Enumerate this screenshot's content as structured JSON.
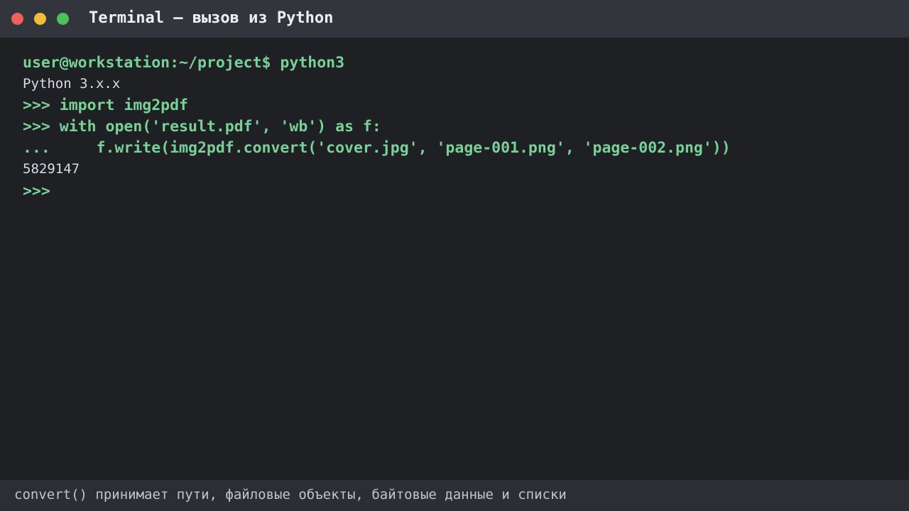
{
  "window": {
    "title": "Terminal — вызов из Python",
    "controls": {
      "close_color": "#f0605a",
      "minimize_color": "#f4bd38",
      "maximize_color": "#4cc15c"
    }
  },
  "terminal": {
    "lines": [
      {
        "kind": "command",
        "text": "user@workstation:~/project$ python3"
      },
      {
        "kind": "output",
        "text": "Python 3.x.x"
      },
      {
        "kind": "command",
        "text": ">>> import img2pdf"
      },
      {
        "kind": "command",
        "text": ">>> with open('result.pdf', 'wb') as f:"
      },
      {
        "kind": "command",
        "text": "...     f.write(img2pdf.convert('cover.jpg', 'page-001.png', 'page-002.png'))"
      },
      {
        "kind": "output",
        "text": "5829147"
      },
      {
        "kind": "command",
        "text": ">>>"
      }
    ]
  },
  "status_bar": {
    "text": "convert() принимает пути, файловые объекты, байтовые данные и списки"
  },
  "colors": {
    "background": "#1f2024",
    "titlebar": "#33353c",
    "prompt_green": "#79d198",
    "output_text": "#d8dbe0",
    "statusbar": "#2c2e34"
  }
}
